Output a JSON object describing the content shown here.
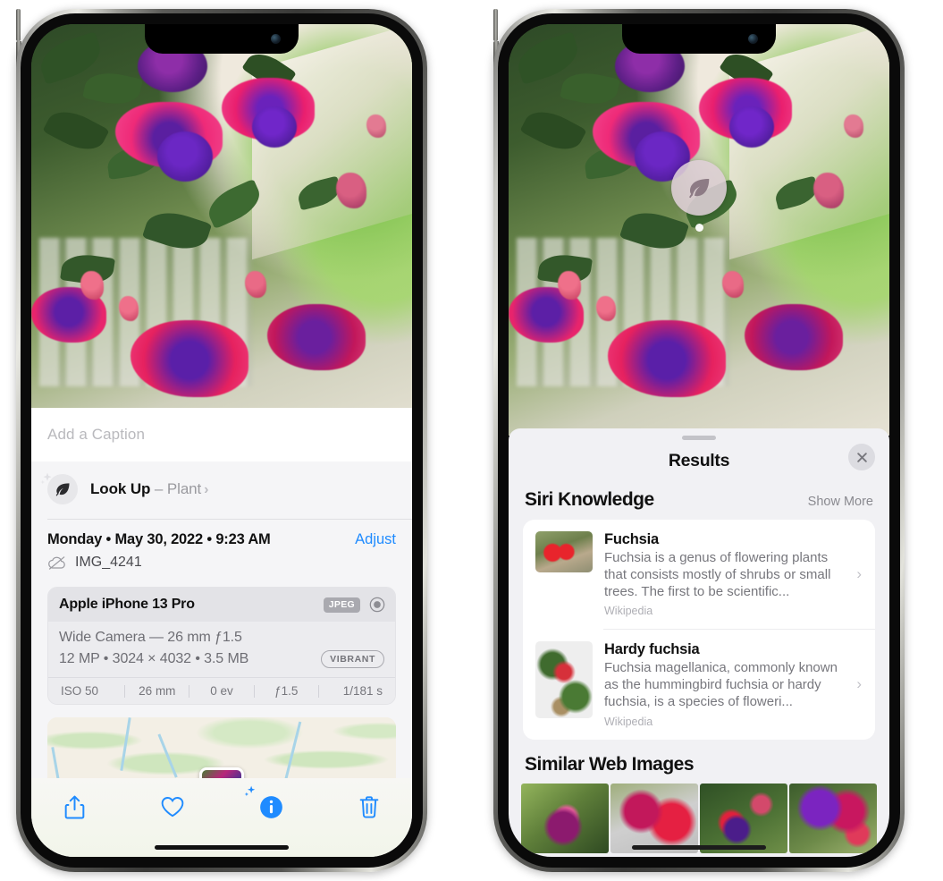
{
  "left_phone": {
    "name": "iphone-photos-info",
    "caption": {
      "placeholder": "Add a Caption",
      "value": ""
    },
    "lookup": {
      "label": "Look Up",
      "dash": " – ",
      "subject": "Plant",
      "chevron": "›",
      "icon": "leaf-icon"
    },
    "date": {
      "text": "Monday • May 30, 2022 • 9:23 AM",
      "adjust_label": "Adjust"
    },
    "file": {
      "name": "IMG_4241",
      "icon": "icloud-slash-icon"
    },
    "meta": {
      "device": "Apple iPhone 13 Pro",
      "format_badge": "JPEG",
      "aperture_icon": "camera-aperture-icon",
      "lens": "Wide Camera — 26 mm ƒ1.5",
      "size_line": "12 MP • 3024 × 4032 • 3.5 MB",
      "style_badge": "VIBRANT",
      "exif": [
        "ISO 50",
        "26 mm",
        "0 ev",
        "ƒ1.5",
        "1/181 s"
      ]
    },
    "toolbar": [
      {
        "name": "share-button",
        "icon": "share-icon"
      },
      {
        "name": "favorite-button",
        "icon": "heart-icon"
      },
      {
        "name": "info-button",
        "icon": "info-sparkle-icon"
      },
      {
        "name": "delete-button",
        "icon": "trash-icon"
      }
    ]
  },
  "right_phone": {
    "name": "iphone-visual-lookup-results",
    "badge": {
      "icon": "leaf-icon"
    },
    "sheet": {
      "title": "Results",
      "close_label": "close-icon",
      "siri_knowledge": {
        "title": "Siri Knowledge",
        "show_more": "Show More",
        "items": [
          {
            "title": "Fuchsia",
            "description": "Fuchsia is a genus of flowering plants that consists mostly of shrubs or small trees. The first to be scientific...",
            "source": "Wikipedia",
            "chevron": "›"
          },
          {
            "title": "Hardy fuchsia",
            "description": "Fuchsia magellanica, commonly known as the hummingbird fuchsia or hardy fuchsia, is a species of floweri...",
            "source": "Wikipedia",
            "chevron": "›"
          }
        ]
      },
      "similar_web_images": {
        "title": "Similar Web Images",
        "count": 4
      }
    }
  },
  "colors": {
    "accent_blue": "#1f8bff",
    "sheet_bg": "#f1f1f4",
    "card_bg": "#ffffff",
    "meta_bg": "#ececef",
    "secondary_text": "#77777d"
  }
}
